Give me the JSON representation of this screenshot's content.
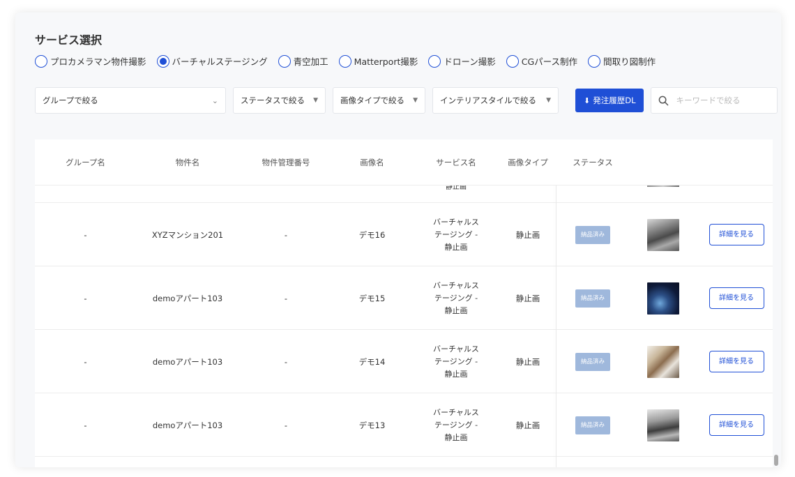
{
  "title": "サービス選択",
  "services": [
    {
      "label": "プロカメラマン物件撮影",
      "selected": false
    },
    {
      "label": "バーチャルステージング",
      "selected": true
    },
    {
      "label": "青空加工",
      "selected": false
    },
    {
      "label": "Matterport撮影",
      "selected": false
    },
    {
      "label": "ドローン撮影",
      "selected": false
    },
    {
      "label": "CGパース制作",
      "selected": false
    },
    {
      "label": "間取り図制作",
      "selected": false
    }
  ],
  "filters": {
    "group": "グループで絞る",
    "status": "ステータスで絞る",
    "image_type": "画像タイプで絞る",
    "interior": "インテリアスタイルで絞る",
    "download_label": "発注履歴DL",
    "search_placeholder": "キーワードで絞る"
  },
  "table": {
    "headers": [
      "グループ名",
      "物件名",
      "物件管理番号",
      "画像名",
      "サービス名",
      "画像タイプ",
      "ステータス"
    ],
    "partial_row_text": "静止画",
    "rows": [
      {
        "group": "-",
        "property": "XYZマンション201",
        "mgmt_no": "-",
        "image_name": "デモ16",
        "service": "バーチャルス\nテージング -\n静止画",
        "image_type": "静止画",
        "status": "納品済み",
        "action": "詳細を見る"
      },
      {
        "group": "-",
        "property": "demoアパート103",
        "mgmt_no": "-",
        "image_name": "デモ15",
        "service": "バーチャルス\nテージング -\n静止画",
        "image_type": "静止画",
        "status": "納品済み",
        "action": "詳細を見る"
      },
      {
        "group": "-",
        "property": "demoアパート103",
        "mgmt_no": "-",
        "image_name": "デモ14",
        "service": "バーチャルス\nテージング -\n静止画",
        "image_type": "静止画",
        "status": "納品済み",
        "action": "詳細を見る"
      },
      {
        "group": "-",
        "property": "demoアパート103",
        "mgmt_no": "-",
        "image_name": "デモ13",
        "service": "バーチャルス\nテージング -\n静止画",
        "image_type": "静止画",
        "status": "納品済み",
        "action": "詳細を見る"
      }
    ]
  },
  "colors": {
    "accent": "#1f4fd6",
    "badge": "#9fb8dc"
  }
}
